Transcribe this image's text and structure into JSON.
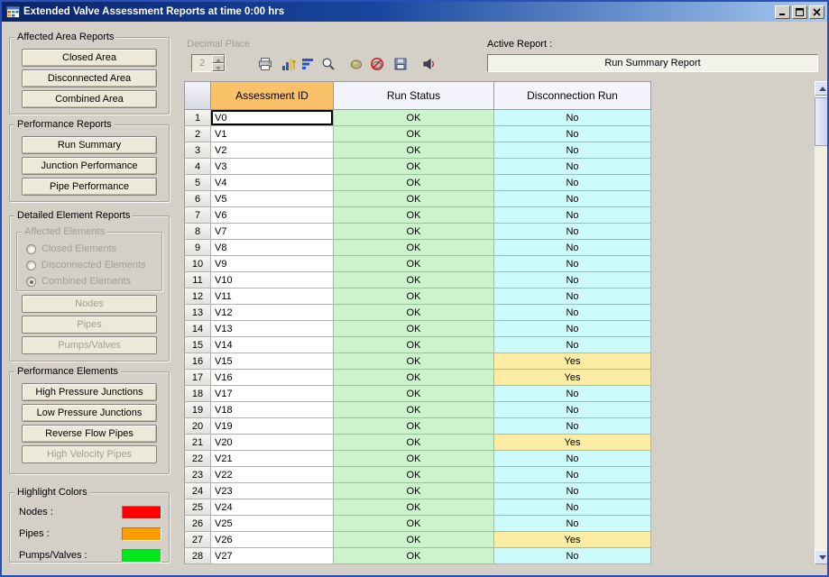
{
  "window": {
    "title": "Extended Valve Assessment Reports at time 0:00 hrs"
  },
  "sidebar": {
    "affected_area_reports": {
      "title": "Affected Area Reports",
      "buttons": [
        "Closed Area",
        "Disconnected Area",
        "Combined Area"
      ]
    },
    "performance_reports": {
      "title": "Performance Reports",
      "buttons": [
        "Run Summary",
        "Junction Performance",
        "Pipe Performance"
      ]
    },
    "detailed_element_reports": {
      "title": "Detailed Element Reports",
      "affected_elements": {
        "title": "Affected Elements",
        "options": [
          {
            "label": "Closed Elements",
            "selected": false
          },
          {
            "label": "Disconnected Elements",
            "selected": false
          },
          {
            "label": "Combined Elements",
            "selected": true
          }
        ]
      },
      "buttons": [
        "Nodes",
        "Pipes",
        "Pumps/Valves"
      ]
    },
    "performance_elements": {
      "title": "Performance Elements",
      "buttons": [
        {
          "label": "High Pressure Junctions",
          "enabled": true
        },
        {
          "label": "Low Pressure Junctions",
          "enabled": true
        },
        {
          "label": "Reverse Flow Pipes",
          "enabled": true
        },
        {
          "label": "High Velocity Pipes",
          "enabled": false
        }
      ]
    },
    "highlight_colors": {
      "title": "Highlight Colors",
      "items": [
        {
          "label": "Nodes :",
          "color": "#ff0000"
        },
        {
          "label": "Pipes :",
          "color": "#ff9c00"
        },
        {
          "label": "Pumps/Valves :",
          "color": "#00e81c"
        }
      ]
    }
  },
  "toolbar": {
    "decimal_place": {
      "label": "Decimal Place",
      "value": "2",
      "enabled": false
    },
    "icons": [
      "print-icon",
      "sort-ascending-icon",
      "sort-descending-icon",
      "zoom-icon",
      "highlight-icon",
      "remove-highlight-icon",
      "save-icon",
      "sound-icon"
    ]
  },
  "active_report": {
    "label": "Active Report :",
    "value": "Run Summary Report"
  },
  "grid": {
    "columns": [
      "Assessment ID",
      "Run Status",
      "Disconnection Run"
    ],
    "selected_cell": {
      "row": 1,
      "column": "Assessment ID"
    },
    "rows": [
      {
        "n": 1,
        "id": "V0",
        "status": "OK",
        "disc": "No"
      },
      {
        "n": 2,
        "id": "V1",
        "status": "OK",
        "disc": "No"
      },
      {
        "n": 3,
        "id": "V2",
        "status": "OK",
        "disc": "No"
      },
      {
        "n": 4,
        "id": "V3",
        "status": "OK",
        "disc": "No"
      },
      {
        "n": 5,
        "id": "V4",
        "status": "OK",
        "disc": "No"
      },
      {
        "n": 6,
        "id": "V5",
        "status": "OK",
        "disc": "No"
      },
      {
        "n": 7,
        "id": "V6",
        "status": "OK",
        "disc": "No"
      },
      {
        "n": 8,
        "id": "V7",
        "status": "OK",
        "disc": "No"
      },
      {
        "n": 9,
        "id": "V8",
        "status": "OK",
        "disc": "No"
      },
      {
        "n": 10,
        "id": "V9",
        "status": "OK",
        "disc": "No"
      },
      {
        "n": 11,
        "id": "V10",
        "status": "OK",
        "disc": "No"
      },
      {
        "n": 12,
        "id": "V11",
        "status": "OK",
        "disc": "No"
      },
      {
        "n": 13,
        "id": "V12",
        "status": "OK",
        "disc": "No"
      },
      {
        "n": 14,
        "id": "V13",
        "status": "OK",
        "disc": "No"
      },
      {
        "n": 15,
        "id": "V14",
        "status": "OK",
        "disc": "No"
      },
      {
        "n": 16,
        "id": "V15",
        "status": "OK",
        "disc": "Yes"
      },
      {
        "n": 17,
        "id": "V16",
        "status": "OK",
        "disc": "Yes"
      },
      {
        "n": 18,
        "id": "V17",
        "status": "OK",
        "disc": "No"
      },
      {
        "n": 19,
        "id": "V18",
        "status": "OK",
        "disc": "No"
      },
      {
        "n": 20,
        "id": "V19",
        "status": "OK",
        "disc": "No"
      },
      {
        "n": 21,
        "id": "V20",
        "status": "OK",
        "disc": "Yes"
      },
      {
        "n": 22,
        "id": "V21",
        "status": "OK",
        "disc": "No"
      },
      {
        "n": 23,
        "id": "V22",
        "status": "OK",
        "disc": "No"
      },
      {
        "n": 24,
        "id": "V23",
        "status": "OK",
        "disc": "No"
      },
      {
        "n": 25,
        "id": "V24",
        "status": "OK",
        "disc": "No"
      },
      {
        "n": 26,
        "id": "V25",
        "status": "OK",
        "disc": "No"
      },
      {
        "n": 27,
        "id": "V26",
        "status": "OK",
        "disc": "Yes"
      },
      {
        "n": 28,
        "id": "V27",
        "status": "OK",
        "disc": "No"
      }
    ]
  }
}
